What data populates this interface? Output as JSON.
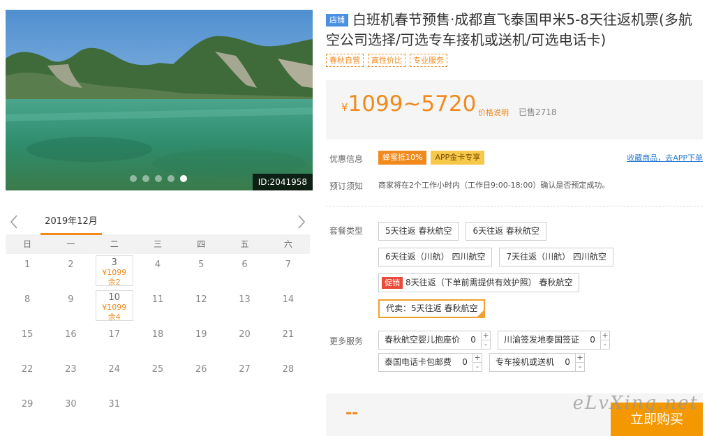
{
  "hero": {
    "image_id": "ID:2041958",
    "slide_count": 5,
    "active_slide": 5
  },
  "calendar": {
    "month_label": "2019年12月",
    "weekdays": [
      "日",
      "一",
      "二",
      "三",
      "四",
      "五",
      "六"
    ],
    "days": [
      {
        "n": "1"
      },
      {
        "n": "2"
      },
      {
        "n": "3",
        "price": "¥1099",
        "remain": "余2"
      },
      {
        "n": "4"
      },
      {
        "n": "5"
      },
      {
        "n": "6"
      },
      {
        "n": "7"
      },
      {
        "n": "8"
      },
      {
        "n": "9"
      },
      {
        "n": "10",
        "price": "¥1099",
        "remain": "余4"
      },
      {
        "n": "11"
      },
      {
        "n": "12"
      },
      {
        "n": "13"
      },
      {
        "n": "14"
      },
      {
        "n": "15"
      },
      {
        "n": "16"
      },
      {
        "n": "17"
      },
      {
        "n": "18"
      },
      {
        "n": "19"
      },
      {
        "n": "20"
      },
      {
        "n": "21"
      },
      {
        "n": "22"
      },
      {
        "n": "23"
      },
      {
        "n": "24"
      },
      {
        "n": "25"
      },
      {
        "n": "26"
      },
      {
        "n": "27"
      },
      {
        "n": "28"
      },
      {
        "n": "29"
      },
      {
        "n": "30"
      },
      {
        "n": "31"
      }
    ]
  },
  "product": {
    "shop_badge": "店铺",
    "title": "白班机春节预售·成都直飞泰国甲米5-8天往返机票(多航空公司选择/可选专车接机或送机/可选电话卡)",
    "tags": [
      "春秋自营",
      "高性价比",
      "专业服务"
    ],
    "price_currency": "¥",
    "price_value": "1099~5720",
    "price_note": "价格说明",
    "sold": "已售2718"
  },
  "promo": {
    "label": "优惠信息",
    "badges": [
      "蜂蜜抵10%",
      "APP金卡专享"
    ],
    "fav_link": "收藏商品，去APP下单"
  },
  "notice": {
    "label": "预订须知",
    "text": "商家将在2个工作小时内（工作日9:00-18:00）确认是否预定成功。"
  },
  "packages": {
    "label": "套餐类型",
    "items": [
      "5天往返 春秋航空",
      "6天往返 春秋航空",
      "6天往返（川航） 四川航空",
      "7天往返（川航） 四川航空",
      "8天往返（下单前需提供有效护照） 春秋航空",
      "代卖：5天往返 春秋航空"
    ],
    "hot_badge": "促销"
  },
  "services": {
    "label": "更多服务",
    "items": [
      {
        "name": "春秋航空婴儿抱座价",
        "count": "0"
      },
      {
        "name": "川渝签发地泰国签证",
        "count": "0"
      },
      {
        "name": "泰国电话卡包邮费",
        "count": "0"
      },
      {
        "name": "专车接机或送机",
        "count": "0"
      }
    ],
    "plus": "+",
    "minus": "-"
  },
  "buy": {
    "total": "--",
    "button": "立即购买"
  },
  "watermark": "eLvXing.net",
  "colors": {
    "accent": "#f08a1d",
    "buy_button": "#f39800",
    "link": "#2a7ad4",
    "hot": "#e84b3a"
  }
}
